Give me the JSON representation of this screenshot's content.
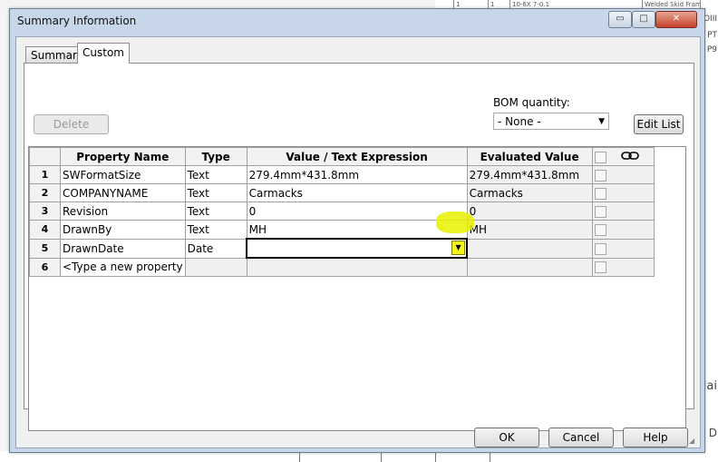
{
  "window": {
    "title": "Summary Information",
    "minimize_glyph": "▭",
    "maximize_glyph": "□",
    "close_glyph": "✕"
  },
  "tabs": [
    {
      "label": "Summary",
      "active": false
    },
    {
      "label": "Custom",
      "active": true
    }
  ],
  "toolbar": {
    "delete_label": "Delete",
    "bom_label": "BOM quantity:",
    "bom_value": "- None -",
    "edit_list_label": "Edit List"
  },
  "grid": {
    "columns": [
      "Property Name",
      "Type",
      "Value / Text Expression",
      "Evaluated Value"
    ],
    "link_icon": "link-icon",
    "rows": [
      {
        "num": "1",
        "name": "SWFormatSize",
        "type": "Text",
        "value": "279.4mm*431.8mm",
        "evaluated": "279.4mm*431.8mm"
      },
      {
        "num": "2",
        "name": "COMPANYNAME",
        "type": "Text",
        "value": "Carmacks",
        "evaluated": "Carmacks"
      },
      {
        "num": "3",
        "name": "Revision",
        "type": "Text",
        "value": "0",
        "evaluated": "0"
      },
      {
        "num": "4",
        "name": "DrawnBy",
        "type": "Text",
        "value": "MH",
        "evaluated": "MH"
      },
      {
        "num": "5",
        "name": "DrawnDate",
        "type": "Date",
        "value": "",
        "evaluated": ""
      },
      {
        "num": "6",
        "name": "<Type a new property",
        "type": "",
        "value": "",
        "evaluated": ""
      }
    ]
  },
  "footer": {
    "ok_label": "OK",
    "cancel_label": "Cancel",
    "help_label": "Help"
  },
  "background": {
    "top_fragments": [
      "1",
      "1",
      "10-6X 7-0.1",
      "Welded Skid Frame"
    ],
    "side_fragments": [
      "ΟΙΙΙ",
      "PT",
      "P9",
      "lai",
      "D"
    ]
  },
  "colors": {
    "dialog_frame": "#c7d6e8",
    "highlight": "#e8f000"
  }
}
